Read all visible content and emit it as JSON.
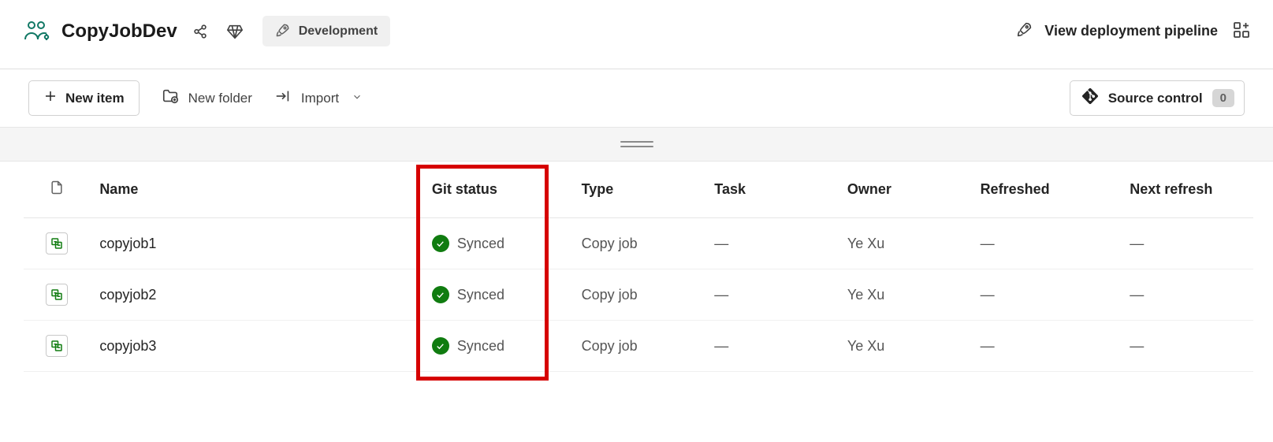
{
  "header": {
    "title": "CopyJobDev",
    "stage_label": "Development",
    "pipeline_link": "View deployment pipeline"
  },
  "toolbar": {
    "new_item": "New item",
    "new_folder": "New folder",
    "import": "Import",
    "source_control": "Source control",
    "source_control_count": "0"
  },
  "table": {
    "columns": {
      "name": "Name",
      "git_status": "Git status",
      "type": "Type",
      "task": "Task",
      "owner": "Owner",
      "refreshed": "Refreshed",
      "next_refresh": "Next refresh"
    },
    "rows": [
      {
        "name": "copyjob1",
        "git_status": "Synced",
        "type": "Copy job",
        "task": "—",
        "owner": "Ye Xu",
        "refreshed": "—",
        "next_refresh": "—"
      },
      {
        "name": "copyjob2",
        "git_status": "Synced",
        "type": "Copy job",
        "task": "—",
        "owner": "Ye Xu",
        "refreshed": "—",
        "next_refresh": "—"
      },
      {
        "name": "copyjob3",
        "git_status": "Synced",
        "type": "Copy job",
        "task": "—",
        "owner": "Ye Xu",
        "refreshed": "—",
        "next_refresh": "—"
      }
    ]
  },
  "colors": {
    "git_synced": "#107C10",
    "highlight": "#d60000"
  }
}
